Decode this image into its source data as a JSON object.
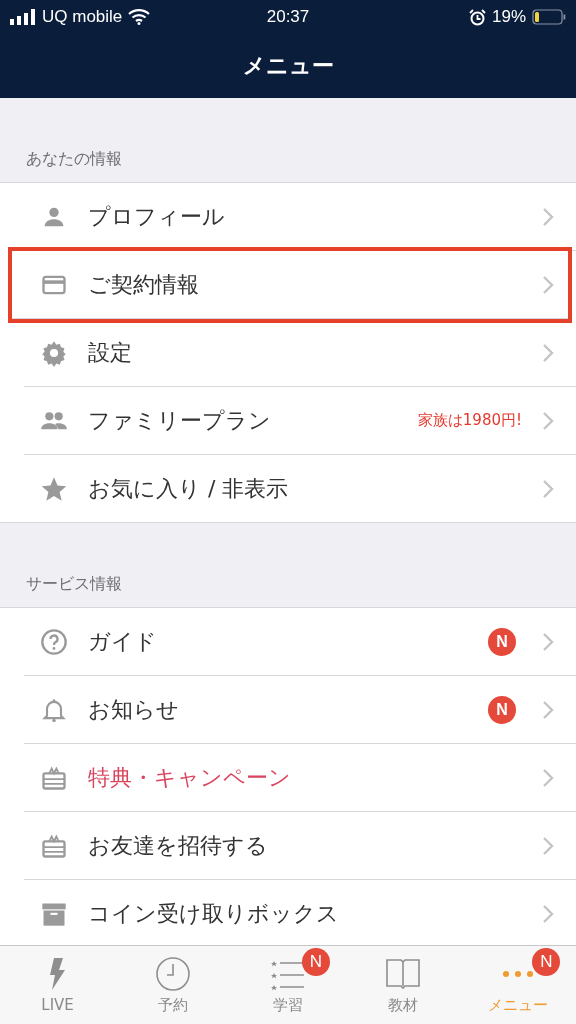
{
  "status_bar": {
    "carrier": "UQ mobile",
    "time": "20:37",
    "battery": "19%"
  },
  "nav": {
    "title": "メニュー"
  },
  "sections": [
    {
      "header": "あなたの情報",
      "items": [
        {
          "kind": "person",
          "label": "プロフィール",
          "highlighted": false,
          "accent": false
        },
        {
          "kind": "card",
          "label": "ご契約情報",
          "highlighted": true,
          "accent": false
        },
        {
          "kind": "gear",
          "label": "設定",
          "highlighted": false,
          "accent": false
        },
        {
          "kind": "people",
          "label": "ファミリープラン",
          "note": "家族は1980円!",
          "highlighted": false,
          "accent": false
        },
        {
          "kind": "star",
          "label": "お気に入り / 非表示",
          "highlighted": false,
          "accent": false
        }
      ]
    },
    {
      "header": "サービス情報",
      "items": [
        {
          "kind": "help",
          "label": "ガイド",
          "badge": "N",
          "highlighted": false,
          "accent": false
        },
        {
          "kind": "bell",
          "label": "お知らせ",
          "badge": "N",
          "highlighted": false,
          "accent": false
        },
        {
          "kind": "gift",
          "label": "特典・キャンペーン",
          "highlighted": false,
          "accent": true
        },
        {
          "kind": "gift",
          "label": "お友達を招待する",
          "highlighted": false,
          "accent": false
        },
        {
          "kind": "box",
          "label": "コイン受け取りボックス",
          "highlighted": false,
          "accent": false
        }
      ]
    }
  ],
  "tab_bar": [
    {
      "kind": "bolt",
      "label": "LIVE",
      "selected": false
    },
    {
      "kind": "clock",
      "label": "予約",
      "selected": false
    },
    {
      "kind": "list",
      "label": "学習",
      "badge": "N",
      "selected": false
    },
    {
      "kind": "book",
      "label": "教材",
      "selected": false
    },
    {
      "kind": "dots",
      "label": "メニュー",
      "badge": "N",
      "selected": true
    }
  ]
}
